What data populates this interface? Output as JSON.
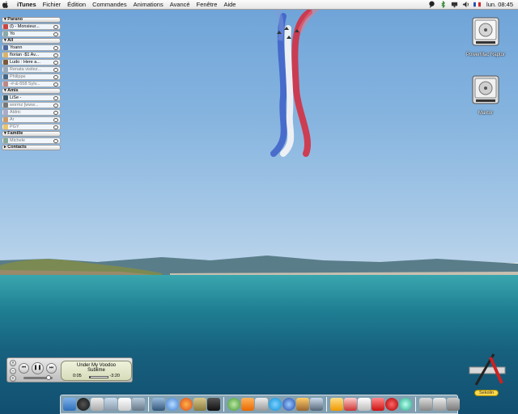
{
  "menubar": {
    "app_name": "iTunes",
    "items": [
      "Fichier",
      "Édition",
      "Commandes",
      "Animations",
      "Avancé",
      "Fenêtre",
      "Aide"
    ],
    "clock": "lun. 08:45",
    "status_icons": [
      "chat-icon",
      "bluetooth-icon",
      "display-icon",
      "volume-icon",
      "flag-icon"
    ]
  },
  "buddylist": {
    "groups": [
      {
        "name": "Parano",
        "buddies": [
          "(l) - Monsieur...",
          "Yo"
        ]
      },
      {
        "name": "All",
        "buddies": [
          "Yoann",
          "florian -$1 Av...",
          "Ludo : Here a...",
          "Renata visitez...",
          "Philippe",
          "-#-&-558 Sylv..."
        ]
      },
      {
        "name": "Amis",
        "buddies": [
          "LiSe -",
          "wormz [www...",
          "Aldric",
          "Ar",
          "PGY"
        ]
      },
      {
        "name": "Famille",
        "buddies": [
          "Michele"
        ]
      },
      {
        "name": "Contacts",
        "buddies": []
      }
    ]
  },
  "desktop_icons": [
    {
      "name": "PowerMac Raptor"
    },
    {
      "name": "Maxtor"
    }
  ],
  "player": {
    "track": "Under My Voodoo",
    "artist": "Sublime",
    "elapsed": "0:05",
    "remaining": "-3:20",
    "progress": 0.025
  },
  "widget": {
    "label": "Sekolin"
  },
  "dock": {
    "items": [
      "finder-icon",
      "dashboard-icon",
      "mail-icon",
      "ichat-icon",
      "itunes-icon",
      "preview-icon",
      "iphoto-icon",
      "safari-icon",
      "firefox-icon",
      "system-prefs-icon",
      "terminal-icon",
      "music-icon",
      "vlc-icon",
      "ical-icon",
      "skype-icon",
      "addressbook-icon",
      "vuze-icon",
      "textedit-icon",
      "photo-icon",
      "acrobat-icon",
      "pages-icon",
      "font-icon",
      "flash-icon",
      "burn-icon",
      "network-icon",
      "disk-icon",
      "trash-icon"
    ]
  }
}
